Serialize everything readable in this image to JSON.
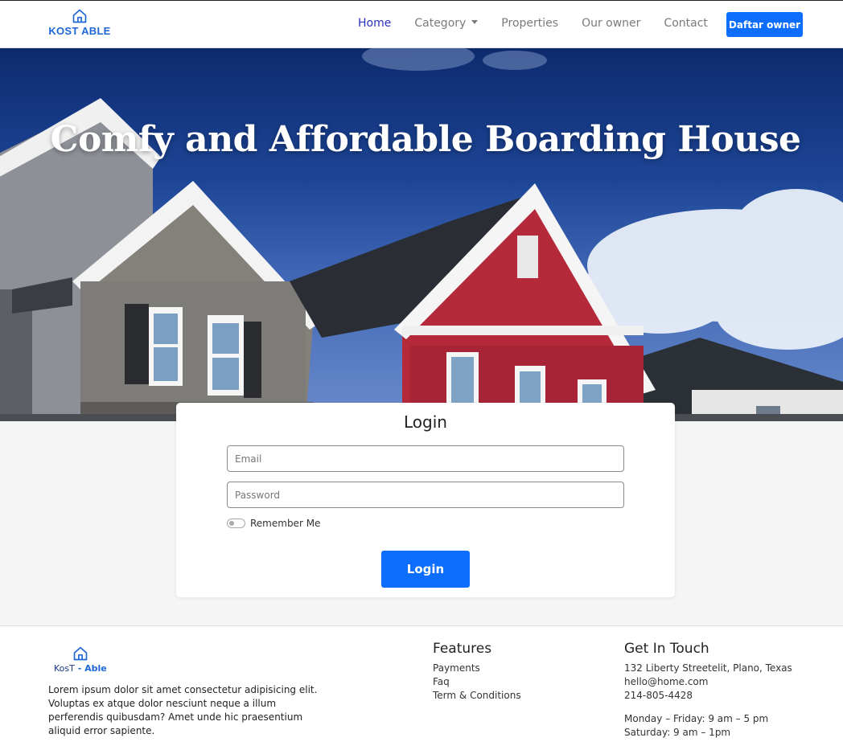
{
  "brand": {
    "name": "KOST ABLE",
    "icon": "house-icon"
  },
  "nav": {
    "items": [
      {
        "label": "Home",
        "active": true
      },
      {
        "label": "Category",
        "dropdown": true
      },
      {
        "label": "Properties"
      },
      {
        "label": "Our owner"
      },
      {
        "label": "Contact"
      }
    ],
    "cta_label": "Daftar owner"
  },
  "hero": {
    "title": "Comfy and Affordable Boarding House"
  },
  "login": {
    "title": "Login",
    "email_placeholder": "Email",
    "password_placeholder": "Password",
    "remember_label": "Remember Me",
    "remember_checked": false,
    "submit_label": "Login"
  },
  "footer": {
    "brand_text_prefix": "KosT",
    "brand_text_suffix": " - Able",
    "description": "Lorem ipsum dolor sit amet consectetur adipisicing elit. Voluptas ex atque dolor nesciunt neque a illum perferendis quibusdam? Amet unde hic praesentium aliquid error sapiente.",
    "features": {
      "title": "Features",
      "links": [
        "Payments",
        "Faq",
        "Term & Conditions"
      ]
    },
    "contact": {
      "title": "Get In Touch",
      "address": "132 Liberty Streetelit, Plano, Texas",
      "email": "hello@home.com",
      "phone": "214-805-4428",
      "hours_weekday": "Monday – Friday: 9 am – 5 pm",
      "hours_saturday": "Saturday: 9 am – 1pm"
    }
  },
  "colors": {
    "primary": "#0d6efd",
    "brand": "#1e66d6",
    "nav_active": "#2a2fbf"
  }
}
